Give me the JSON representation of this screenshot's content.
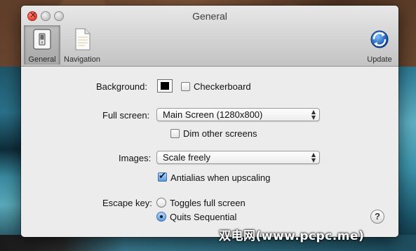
{
  "window": {
    "title": "General"
  },
  "toolbar": {
    "general_label": "General",
    "navigation_label": "Navigation",
    "update_label": "Update"
  },
  "background": {
    "label": "Background:",
    "color": "#000000",
    "checkerboard_label": "Checkerboard",
    "checkerboard_checked": false
  },
  "fullscreen": {
    "label": "Full screen:",
    "value": "Main Screen (1280x800)",
    "dim_label": "Dim other screens",
    "dim_checked": false
  },
  "images": {
    "label": "Images:",
    "value": "Scale freely",
    "antialias_label": "Antialias when upscaling",
    "antialias_checked": true
  },
  "escape": {
    "label": "Escape key:",
    "option1": "Toggles full screen",
    "option2": "Quits Sequential",
    "selected": "Quits Sequential"
  },
  "help": {
    "glyph": "?"
  },
  "watermark": {
    "text": "双电网(www.pcpc.me)"
  }
}
